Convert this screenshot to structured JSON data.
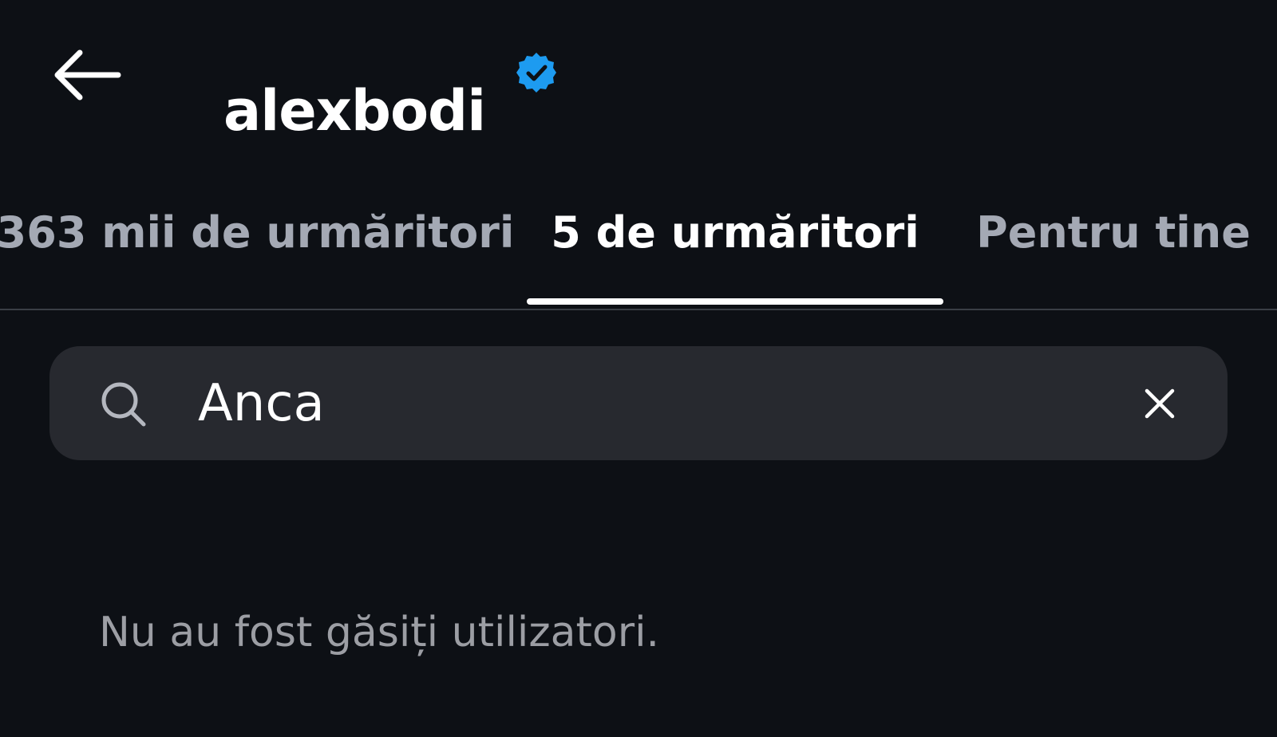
{
  "header": {
    "title": "alexbodi",
    "verified": true,
    "back_icon": "arrow-left-icon",
    "verified_icon": "verified-badge-icon"
  },
  "tabs": [
    {
      "label": "363 mii de urmăritori",
      "active": false
    },
    {
      "label": "5 de urmăritori",
      "active": true
    },
    {
      "label": "Pentru tine",
      "active": false
    }
  ],
  "search": {
    "value": "Anca",
    "placeholder": "",
    "search_icon": "search-icon",
    "clear_icon": "close-icon"
  },
  "results": {
    "empty_message": "Nu au fost găsiți utilizatori."
  },
  "colors": {
    "background": "#0d1015",
    "active_text": "#ffffff",
    "inactive_text": "#a4a9b4",
    "search_background": "#27292f",
    "divider": "#3a3e45",
    "verified": "#1d9bf0",
    "muted_text": "#9c9ea4"
  }
}
